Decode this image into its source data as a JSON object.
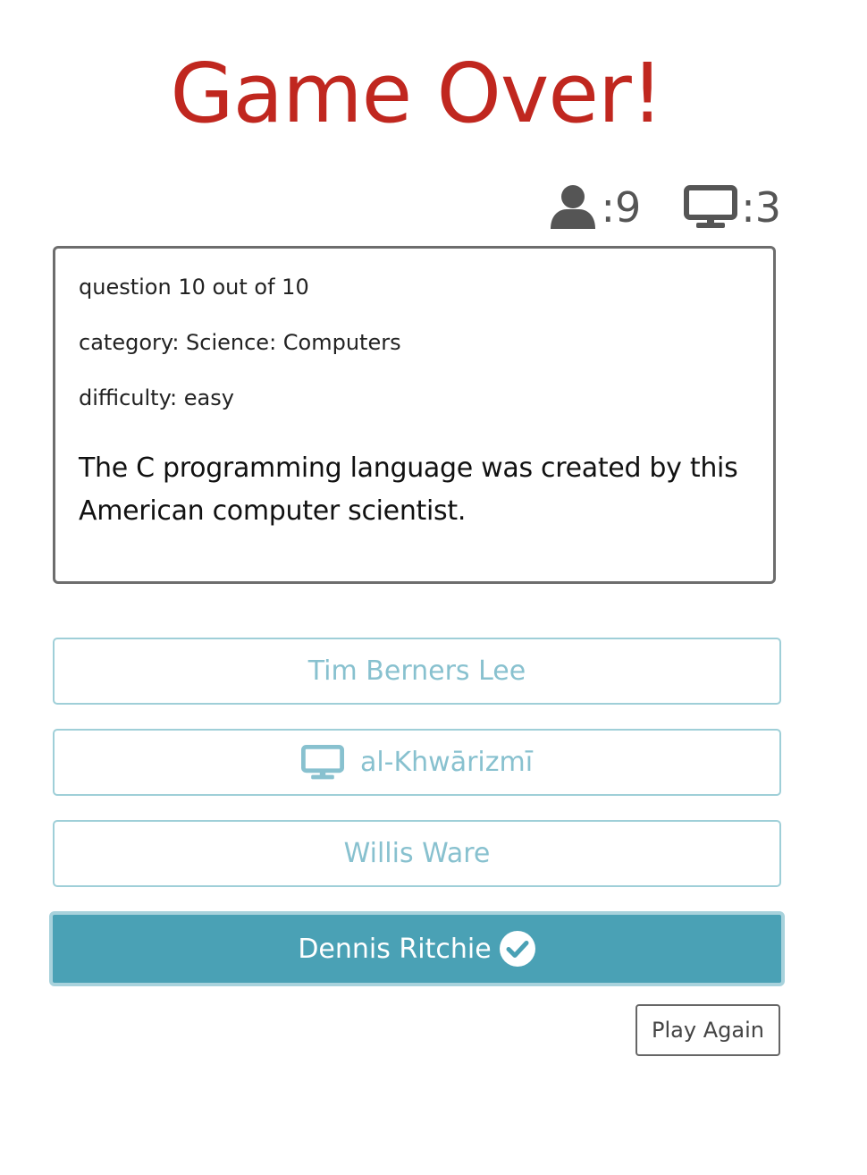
{
  "title": "Game Over!",
  "scores": {
    "player": {
      "icon": "user-icon",
      "value": ":9"
    },
    "computer": {
      "icon": "monitor-icon",
      "value": ":3"
    }
  },
  "question": {
    "progress": "question 10 out of 10",
    "category": "category: Science: Computers",
    "difficulty": "difficulty: easy",
    "text": "The C programming language was created by this American computer scientist."
  },
  "answers": [
    {
      "label": "Tim Berners Lee",
      "state": "default"
    },
    {
      "label": "al-Khwārizmī",
      "state": "computer-pick",
      "icon": "monitor-icon"
    },
    {
      "label": "Willis Ware",
      "state": "default"
    },
    {
      "label": "Dennis Ritchie",
      "state": "correct",
      "icon": "check-circle-icon"
    }
  ],
  "play_again_label": "Play Again",
  "colors": {
    "title": "#c0271f",
    "accent": "#4aa1b5",
    "answer_text": "#88c1cf",
    "answer_border": "#9fcfd8"
  }
}
